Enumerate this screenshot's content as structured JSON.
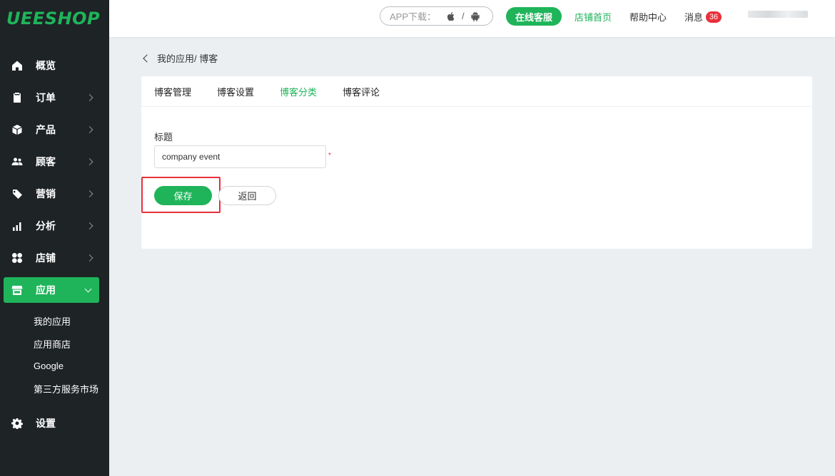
{
  "brand": {
    "logo_text": "UEESHOP",
    "accent_color": "#1fb45a",
    "sidebar_bg": "#1e2326"
  },
  "sidebar": {
    "items": [
      {
        "label": "概览",
        "icon": "home-icon"
      },
      {
        "label": "订单",
        "icon": "clipboard-icon"
      },
      {
        "label": "产品",
        "icon": "box-icon"
      },
      {
        "label": "顾客",
        "icon": "users-icon"
      },
      {
        "label": "营销",
        "icon": "tag-icon"
      },
      {
        "label": "分析",
        "icon": "bar-chart-icon"
      },
      {
        "label": "店铺",
        "icon": "grid-icon"
      },
      {
        "label": "应用",
        "icon": "store-icon"
      },
      {
        "label": "设置",
        "icon": "gear-icon"
      }
    ],
    "sub_items": [
      {
        "label": "我的应用"
      },
      {
        "label": "应用商店"
      },
      {
        "label": "Google"
      },
      {
        "label": "第三方服务市场"
      }
    ]
  },
  "topbar": {
    "app_download_label": "APP下载：",
    "separator": "/",
    "support_label": "在线客服",
    "store_home_label": "店铺首页",
    "help_label": "帮助中心",
    "messages_label": "消息",
    "messages_count": "36"
  },
  "breadcrumb": {
    "text": "我的应用/ 博客"
  },
  "tabs": [
    {
      "label": "博客管理"
    },
    {
      "label": "博客设置"
    },
    {
      "label": "博客分类",
      "active": true
    },
    {
      "label": "博客评论"
    }
  ],
  "form": {
    "title_label": "标题",
    "title_value": "company event",
    "required_mark": "*",
    "save_label": "保存",
    "back_label": "返回"
  }
}
